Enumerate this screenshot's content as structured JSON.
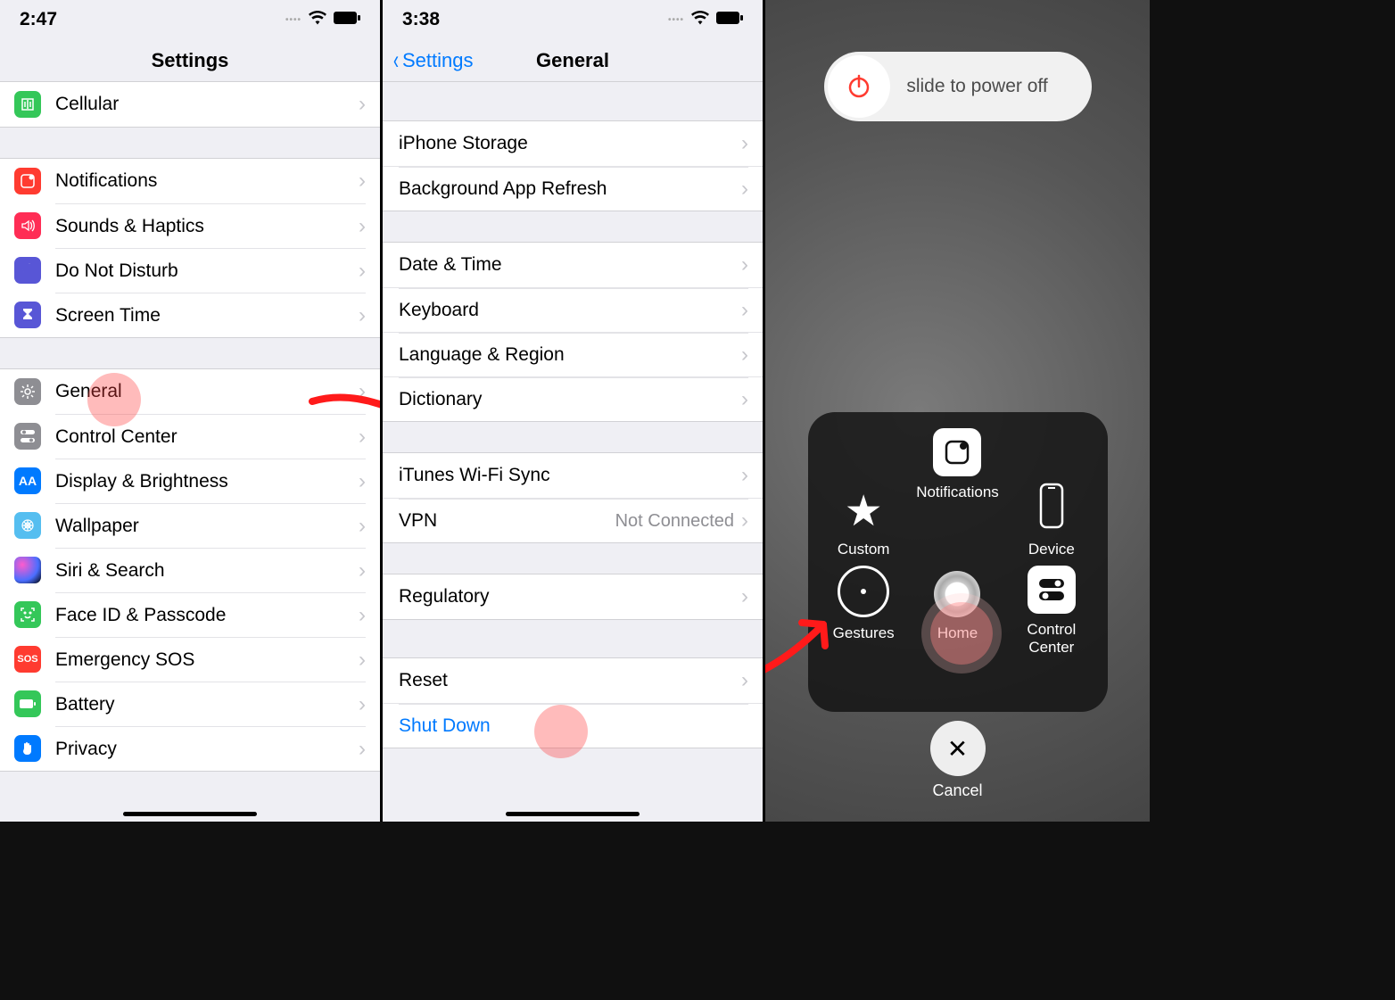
{
  "screen1": {
    "time": "2:47",
    "title": "Settings",
    "rows_group1": [
      "Cellular"
    ],
    "rows_group2": [
      "Notifications",
      "Sounds & Haptics",
      "Do Not Disturb",
      "Screen Time"
    ],
    "rows_group3": [
      "General",
      "Control Center",
      "Display & Brightness",
      "Wallpaper",
      "Siri & Search",
      "Face ID & Passcode",
      "Emergency SOS",
      "Battery",
      "Privacy"
    ]
  },
  "screen2": {
    "time": "3:38",
    "back": "Settings",
    "title": "General",
    "rows_g1": [
      "iPhone Storage",
      "Background App Refresh"
    ],
    "rows_g2": [
      "Date & Time",
      "Keyboard",
      "Language & Region",
      "Dictionary"
    ],
    "rows_g3": [
      {
        "label": "iTunes Wi-Fi Sync",
        "value": ""
      },
      {
        "label": "VPN",
        "value": "Not Connected"
      }
    ],
    "rows_g4": [
      "Regulatory"
    ],
    "rows_g5": [
      "Reset"
    ],
    "shutdown": "Shut Down"
  },
  "screen3": {
    "slider_text": "slide to power off",
    "at": {
      "notifications": "Notifications",
      "custom": "Custom",
      "device": "Device",
      "gestures": "Gestures",
      "home": "Home",
      "control_center": "Control\nCenter"
    },
    "cancel": "Cancel"
  }
}
